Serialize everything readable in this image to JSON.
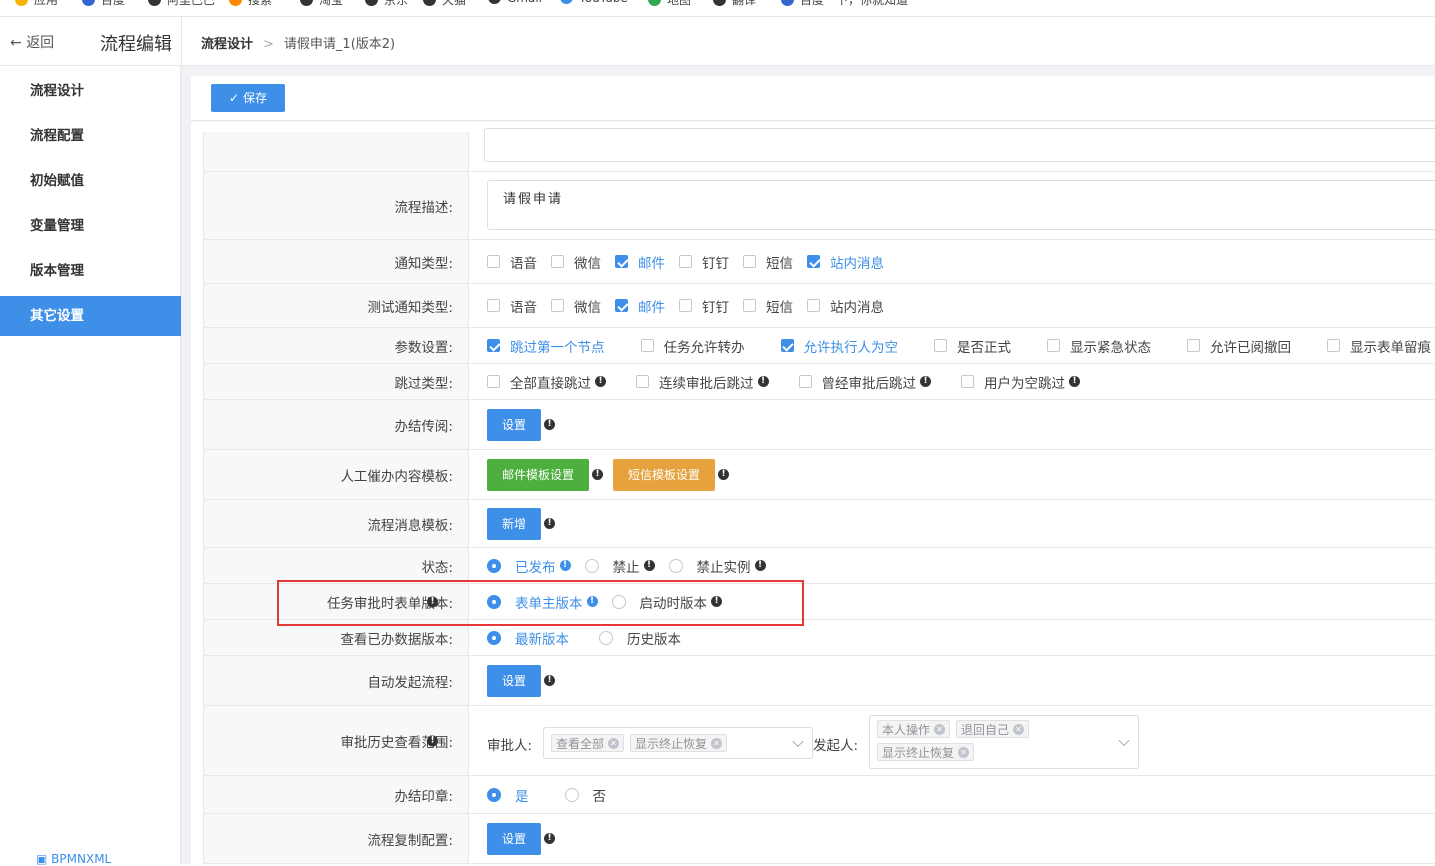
{
  "bookmarks": [
    {
      "label": "应用",
      "color": "#f4b400"
    },
    {
      "label": "百度",
      "color": "#3366cc"
    },
    {
      "label": "阿里巴巴",
      "color": "#333333"
    },
    {
      "label": "搜索",
      "color": "#ff8800"
    },
    {
      "label": "淘宝",
      "color": "#333333"
    },
    {
      "label": "京东",
      "color": "#333333"
    },
    {
      "label": "天猫",
      "color": "#333333"
    },
    {
      "label": "Gmail",
      "color": "#333333"
    },
    {
      "label": "YouTube",
      "color": "#3d8fe8"
    },
    {
      "label": "地图",
      "color": "#34a853"
    },
    {
      "label": "翻译",
      "color": "#333333"
    },
    {
      "label": "百度一下，你就知道",
      "color": "#3366cc"
    }
  ],
  "header": {
    "back_label": "返回",
    "app_title": "流程编辑",
    "breadcrumb": [
      "流程设计",
      "请假申请_1(版本2)"
    ]
  },
  "sidebar": {
    "items": [
      "流程设计",
      "流程配置",
      "初始赋值",
      "变量管理",
      "版本管理",
      "其它设置"
    ],
    "active": "其它设置",
    "footer": "BPMNXML"
  },
  "toolbar": {
    "save_label": "保存"
  },
  "form": {
    "desc": {
      "label": "流程描述:",
      "value": "请假申请"
    },
    "notify": {
      "label": "通知类型:",
      "options": [
        {
          "t": "语音",
          "on": false
        },
        {
          "t": "微信",
          "on": false
        },
        {
          "t": "邮件",
          "on": true
        },
        {
          "t": "钉钉",
          "on": false
        },
        {
          "t": "短信",
          "on": false
        },
        {
          "t": "站内消息",
          "on": true
        }
      ]
    },
    "test_notify": {
      "label": "测试通知类型:",
      "options": [
        {
          "t": "语音",
          "on": false
        },
        {
          "t": "微信",
          "on": false
        },
        {
          "t": "邮件",
          "on": true
        },
        {
          "t": "钉钉",
          "on": false
        },
        {
          "t": "短信",
          "on": false
        },
        {
          "t": "站内消息",
          "on": false
        }
      ]
    },
    "params": {
      "label": "参数设置:",
      "options": [
        {
          "t": "跳过第一个节点",
          "on": true
        },
        {
          "t": "任务允许转办",
          "on": false
        },
        {
          "t": "允许执行人为空",
          "on": true
        },
        {
          "t": "是否正式",
          "on": false
        },
        {
          "t": "显示紧急状态",
          "on": false
        },
        {
          "t": "允许已阅撤回",
          "on": false
        },
        {
          "t": "显示表单留痕",
          "on": false
        }
      ]
    },
    "skip": {
      "label": "跳过类型:",
      "options": [
        {
          "t": "全部直接跳过",
          "on": false
        },
        {
          "t": "连续审批后跳过",
          "on": false
        },
        {
          "t": "曾经审批后跳过",
          "on": false
        },
        {
          "t": "用户为空跳过",
          "on": false
        }
      ]
    },
    "circulate": {
      "label": "办结传阅:",
      "button": "设置"
    },
    "urge": {
      "label": "人工催办内容模板:",
      "email_button": "邮件模板设置",
      "sms_button": "短信模板设置"
    },
    "msg_tpl": {
      "label": "流程消息模板:",
      "button": "新增"
    },
    "status": {
      "label": "状态:",
      "options": [
        {
          "t": "已发布",
          "on": true
        },
        {
          "t": "禁止",
          "on": false
        },
        {
          "t": "禁止实例",
          "on": false
        }
      ]
    },
    "form_version": {
      "label": "任务审批时表单版本",
      "options": [
        {
          "t": "表单主版本",
          "on": true
        },
        {
          "t": "启动时版本",
          "on": false
        }
      ]
    },
    "view_version": {
      "label": "查看已办数据版本:",
      "options": [
        {
          "t": "最新版本",
          "on": true
        },
        {
          "t": "历史版本",
          "on": false
        }
      ]
    },
    "auto_start": {
      "label": "自动发起流程:",
      "button": "设置"
    },
    "history": {
      "label": "审批历史查看范围",
      "approver_label": "审批人:",
      "approver_tags": [
        "查看全部",
        "显示终止恢复"
      ],
      "initiator_label": "发起人:",
      "initiator_tags": [
        "本人操作",
        "退回自己",
        "显示终止恢复"
      ]
    },
    "seal": {
      "label": "办结印章:",
      "options": [
        {
          "t": "是",
          "on": true
        },
        {
          "t": "否",
          "on": false
        }
      ]
    },
    "copy": {
      "label": "流程复制配置:",
      "button": "设置"
    }
  }
}
